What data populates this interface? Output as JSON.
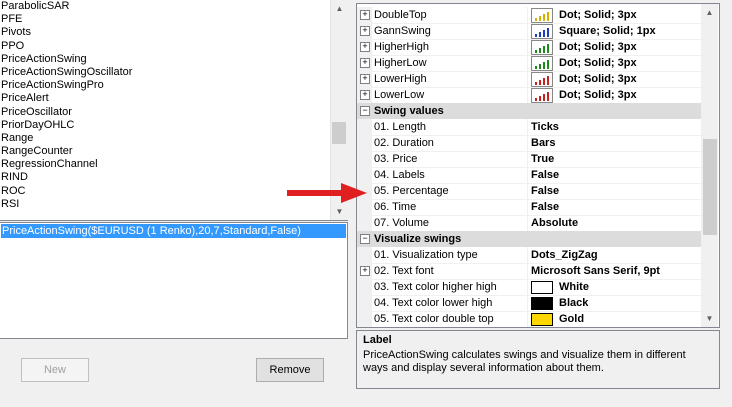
{
  "indicators": [
    "ParabolicSAR",
    "PFE",
    "Pivots",
    "PPO",
    "PriceActionSwing",
    "PriceActionSwingOscillator",
    "PriceActionSwingPro",
    "PriceAlert",
    "PriceOscillator",
    "PriorDayOHLC",
    "Range",
    "RangeCounter",
    "RegressionChannel",
    "RIND",
    "ROC",
    "RSI"
  ],
  "applied": {
    "item": "PriceActionSwing($EURUSD (1 Renko),20,7,Standard,False)"
  },
  "buttons": {
    "new": "New",
    "remove": "Remove"
  },
  "plots": [
    {
      "name": "DoubleTop",
      "value": "Dot; Solid; 3px",
      "color": "#d4b000"
    },
    {
      "name": "GannSwing",
      "value": "Square; Solid; 1px",
      "color": "#1c3fbf"
    },
    {
      "name": "HigherHigh",
      "value": "Dot; Solid; 3px",
      "color": "#1a8a1a"
    },
    {
      "name": "HigherLow",
      "value": "Dot; Solid; 3px",
      "color": "#1a8a1a"
    },
    {
      "name": "LowerHigh",
      "value": "Dot; Solid; 3px",
      "color": "#cc2020"
    },
    {
      "name": "LowerLow",
      "value": "Dot; Solid; 3px",
      "color": "#cc2020"
    }
  ],
  "swing_values": {
    "category": "Swing values",
    "rows": [
      {
        "name": "01. Length",
        "value": "Ticks"
      },
      {
        "name": "02. Duration",
        "value": "Bars"
      },
      {
        "name": "03. Price",
        "value": "True"
      },
      {
        "name": "04. Labels",
        "value": "False"
      },
      {
        "name": "05. Percentage",
        "value": "False"
      },
      {
        "name": "06. Time",
        "value": "False"
      },
      {
        "name": "07. Volume",
        "value": "Absolute"
      }
    ]
  },
  "visualize_swings": {
    "category": "Visualize swings",
    "rows": [
      {
        "name": "01. Visualization type",
        "value": "Dots_ZigZag"
      },
      {
        "name": "02. Text font",
        "value": "Microsoft Sans Serif, 9pt"
      },
      {
        "name": "03. Text color higher high",
        "value": "White",
        "color": "#ffffff"
      },
      {
        "name": "04. Text color lower high",
        "value": "Black",
        "color": "#000000"
      },
      {
        "name": "05. Text color double top",
        "value": "Gold",
        "color": "#ffd700"
      }
    ]
  },
  "help": {
    "title": "Label",
    "text": "PriceActionSwing calculates swings and visualize them in different ways and display several information about them."
  },
  "accent": {
    "selection": "#3399ff",
    "arrow": "#e02020"
  }
}
